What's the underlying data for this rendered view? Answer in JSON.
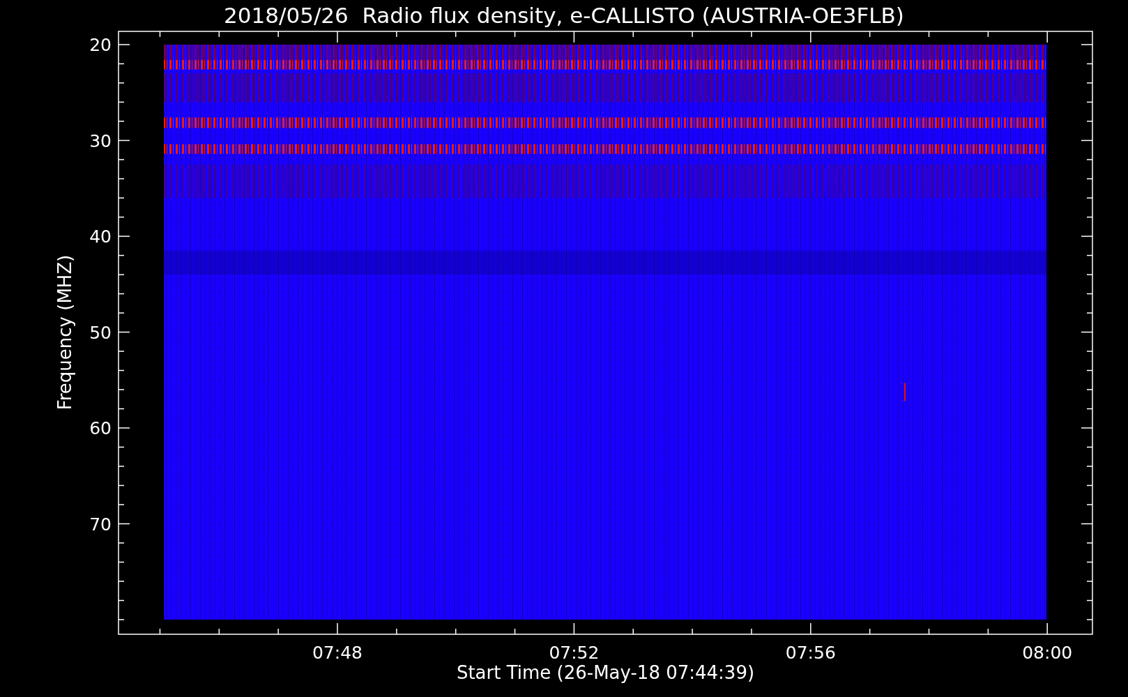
{
  "chart": {
    "title": "2018/05/26  Radio flux density, e-CALLISTO (AUSTRIA-OE3FLB)",
    "ylabel": "Frequency (MHZ)",
    "xlabel": "Start Time (26-May-18 07:44:39)",
    "yticks": [
      "20",
      "30",
      "40",
      "50",
      "60",
      "70"
    ],
    "xticks": [
      "07:48",
      "07:52",
      "07:56",
      "08:00"
    ]
  }
}
